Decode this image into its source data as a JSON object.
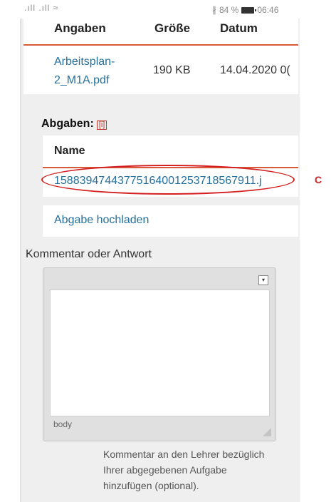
{
  "status_bar": {
    "signal": ".ıll .ıll ≈",
    "bluetooth": "∦",
    "battery_text": "84 %",
    "time": "06:46"
  },
  "table1": {
    "headers": [
      "Angaben",
      "Größe",
      "Datum"
    ],
    "row": {
      "file": "Arbeitsplan-2_M1A.pdf",
      "size": "190 KB",
      "date": "14.04.2020 0("
    }
  },
  "abgaben": {
    "title": "Abgaben:",
    "info_icon": "[i]",
    "name_header": "Name",
    "link": "15883947443775164001253718567911.j",
    "upload": "Abgabe hochladen"
  },
  "annotation": {
    "label": "C",
    "color": "#d42020"
  },
  "comment": {
    "label": "Kommentar oder Antwort",
    "editor_value": "",
    "footer_tag": "body",
    "hint": "Kommentar an den Lehrer bezüglich Ihrer abgegebenen Aufgabe hinzufügen (optional)."
  },
  "colors": {
    "accent": "#d85a3a",
    "link": "#24709d"
  }
}
